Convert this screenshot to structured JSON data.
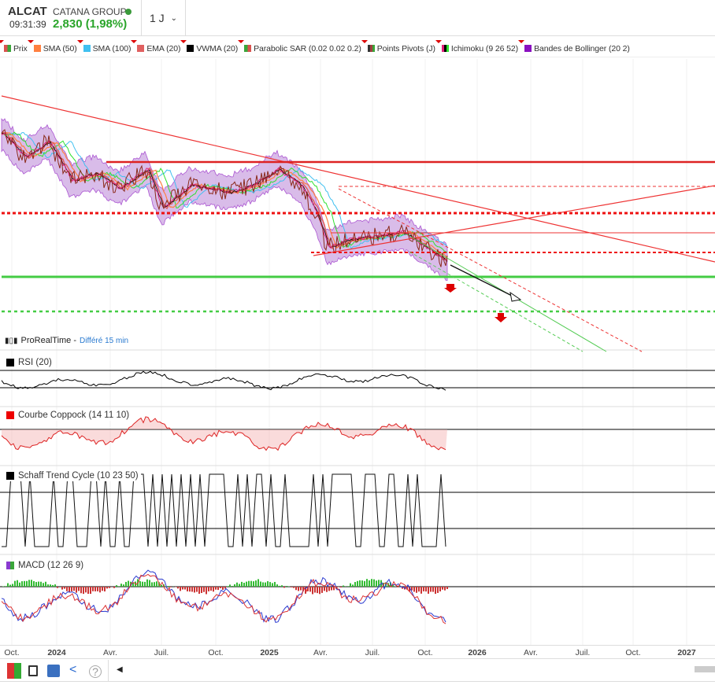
{
  "header": {
    "symbol": "ALCAT",
    "name": "CATANA GROUP",
    "time": "09:31:39",
    "price": "2,830 (1,98%)",
    "period": "1 J"
  },
  "legend": [
    {
      "label": "Prix",
      "colors": [
        "#d9534f",
        "#3aa63a"
      ]
    },
    {
      "label": "SMA (50)",
      "colors": [
        "#ff8040"
      ]
    },
    {
      "label": "SMA (100)",
      "colors": [
        "#40c0f0"
      ]
    },
    {
      "label": "EMA (20)",
      "colors": [
        "#e06060"
      ]
    },
    {
      "label": "VWMA (20)",
      "colors": [
        "#000000"
      ]
    },
    {
      "label": "Parabolic SAR (0.02 0.02 0.2)",
      "colors": [
        "#3aa63a",
        "#d9534f"
      ]
    },
    {
      "label": "Points Pivots (J)",
      "colors": [
        "#333333",
        "#a04040",
        "#3aa63a"
      ]
    },
    {
      "label": "Ichimoku (9 26 52)",
      "colors": [
        "#e0207a",
        "#000000",
        "#30e030"
      ]
    },
    {
      "label": "Bandes de Bollinger (20 2)",
      "colors": [
        "#8a10c0"
      ]
    }
  ],
  "source": {
    "name": "ProRealTime -",
    "delay": "Différé 15 min"
  },
  "panels": {
    "rsi": "RSI (20)",
    "coppock": "Courbe Coppock (14 11 10)",
    "schaff": "Schaff Trend Cycle (10 23 50)",
    "macd": "MACD (12 26 9)"
  },
  "xaxis": [
    {
      "label": "Oct.",
      "year": false
    },
    {
      "label": "2024",
      "year": true
    },
    {
      "label": "Avr.",
      "year": false
    },
    {
      "label": "Juil.",
      "year": false
    },
    {
      "label": "Oct.",
      "year": false
    },
    {
      "label": "2025",
      "year": true
    },
    {
      "label": "Avr.",
      "year": false
    },
    {
      "label": "Juil.",
      "year": false
    },
    {
      "label": "Oct.",
      "year": false
    },
    {
      "label": "2026",
      "year": true
    },
    {
      "label": "Avr.",
      "year": false
    },
    {
      "label": "Juil.",
      "year": false
    },
    {
      "label": "Oct.",
      "year": false
    },
    {
      "label": "2027",
      "year": true
    }
  ],
  "toolbar": [
    "trade-icon",
    "save-icon",
    "layouts-icon",
    "share-icon",
    "help-icon"
  ]
}
